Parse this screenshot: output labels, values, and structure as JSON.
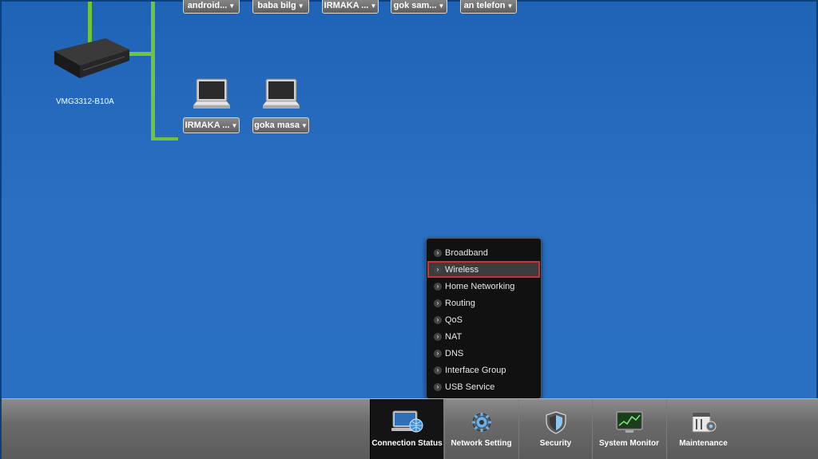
{
  "devices": {
    "top_row": [
      {
        "label": "android..."
      },
      {
        "label": "baba bilg"
      },
      {
        "label": "IRMAKA ..."
      },
      {
        "label": "gok sam..."
      },
      {
        "label": "an telefon"
      }
    ],
    "second_row": [
      {
        "label": "IRMAKA ..."
      },
      {
        "label": "goka masa"
      }
    ]
  },
  "router": {
    "label": "VMG3312-B10A"
  },
  "submenu": {
    "items": [
      {
        "label": "Broadband"
      },
      {
        "label": "Wireless",
        "selected": true
      },
      {
        "label": "Home Networking"
      },
      {
        "label": "Routing"
      },
      {
        "label": "QoS"
      },
      {
        "label": "NAT"
      },
      {
        "label": "DNS"
      },
      {
        "label": "Interface Group"
      },
      {
        "label": "USB Service"
      }
    ]
  },
  "taskbar": {
    "tabs": [
      {
        "label": "Connection Status",
        "icon": "monitor-globe-icon",
        "active": true
      },
      {
        "label": "Network Setting",
        "icon": "gear-icon"
      },
      {
        "label": "Security",
        "icon": "shield-icon"
      },
      {
        "label": "System Monitor",
        "icon": "chart-monitor-icon"
      },
      {
        "label": "Maintenance",
        "icon": "tools-icon"
      }
    ]
  },
  "colors": {
    "background": "#2a6fc1",
    "network_line": "#6fc43a",
    "selection_outline": "#c5333b"
  }
}
